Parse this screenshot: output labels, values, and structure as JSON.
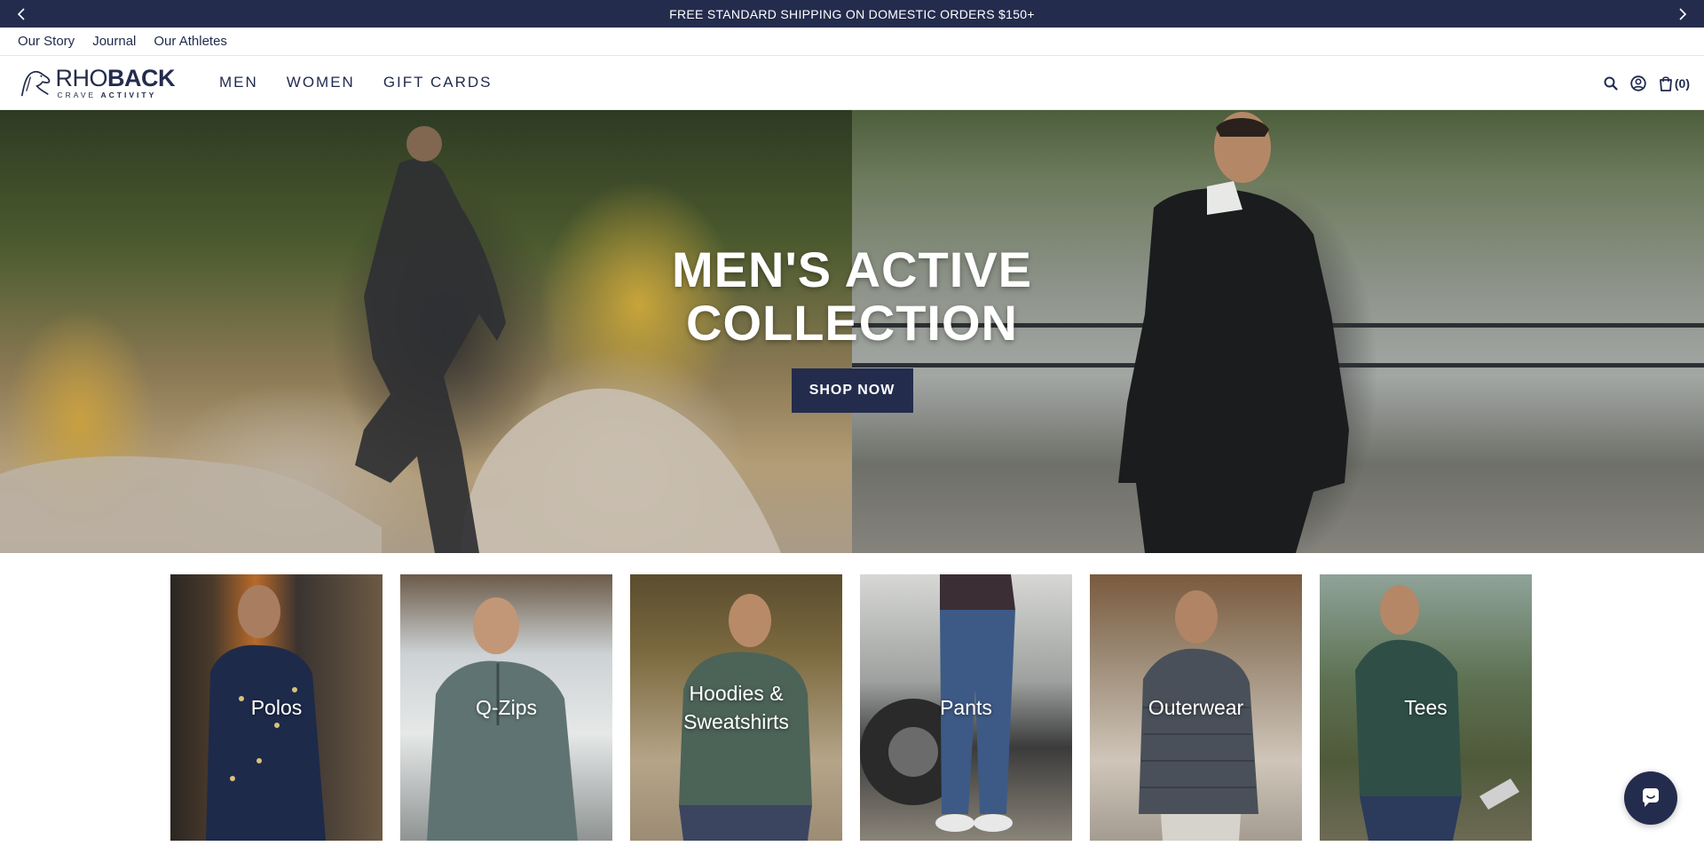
{
  "announcement": {
    "text": "FREE STANDARD SHIPPING ON DOMESTIC ORDERS $150+",
    "prev_icon": "chevron-left-icon",
    "next_icon": "chevron-right-icon"
  },
  "utility_nav": {
    "items": [
      "Our Story",
      "Journal",
      "Our Athletes"
    ]
  },
  "brand": {
    "name_light": "RHO",
    "name_bold": "BACK",
    "tagline_light": "CRAVE",
    "tagline_bold": "ACTIVITY"
  },
  "main_nav": {
    "items": [
      "MEN",
      "WOMEN",
      "GIFT CARDS"
    ]
  },
  "header_icons": {
    "search": "search-icon",
    "account": "account-icon",
    "cart": "bag-icon",
    "cart_count": "(0)"
  },
  "hero": {
    "title_line1": "MEN'S ACTIVE",
    "title_line2": "COLLECTION",
    "cta": "SHOP NOW"
  },
  "categories": [
    {
      "label": "Polos"
    },
    {
      "label": "Q-Zips"
    },
    {
      "label": "Hoodies & Sweatshirts"
    },
    {
      "label": "Pants"
    },
    {
      "label": "Outerwear"
    },
    {
      "label": "Tees"
    }
  ],
  "chat": {
    "icon": "chat-icon"
  },
  "colors": {
    "brand_navy": "#242c4d",
    "text": "#1f2a4d"
  }
}
